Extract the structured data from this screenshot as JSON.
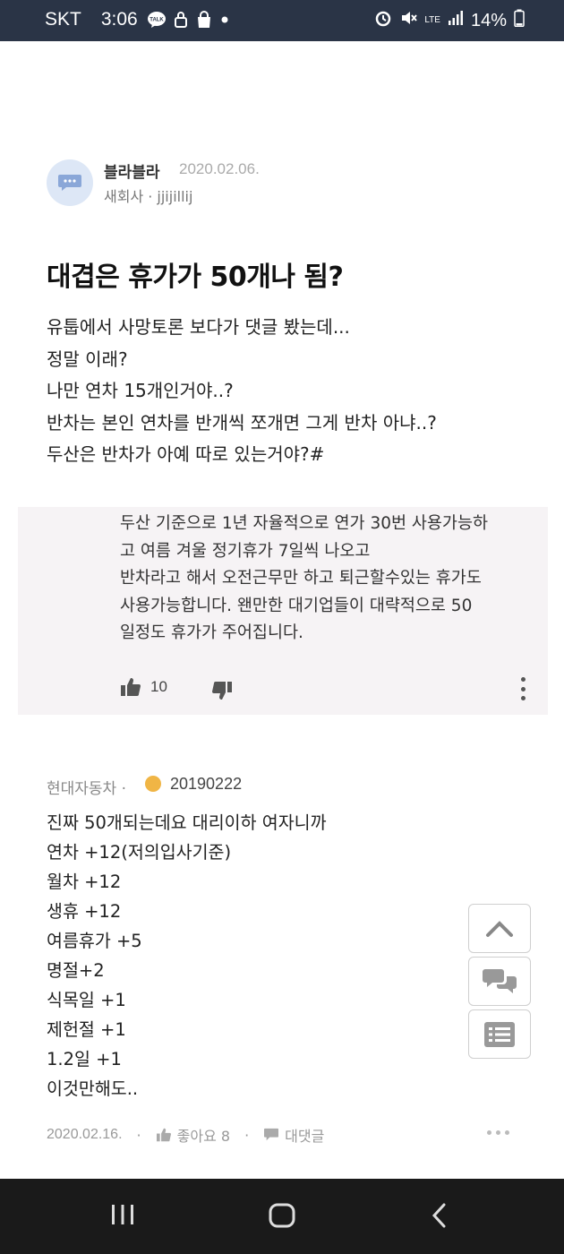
{
  "status_bar": {
    "carrier": "SKT",
    "time": "3:06",
    "talk_label": "TALK",
    "network": "LTE",
    "battery": "14%",
    "icons": [
      "talk-icon",
      "lock-icon",
      "shopping-bag-icon",
      "alarm-icon",
      "mute-icon",
      "signal-icon",
      "battery-icon"
    ]
  },
  "post": {
    "author": "블라블라",
    "date": "2020.02.06.",
    "meta": "새회사 · jjijillij",
    "title": "대겹은 휴가가 50개나 됨?",
    "body_lines": [
      "유툽에서 사망토론 보다가 댓글 봤는데...",
      "정말 이래?",
      "나만 연차 15개인거야..?",
      "반차는 본인 연차를 반개씩 쪼개면 그게 반차 아냐..?",
      "두산은 반차가 아예 따로 있는거야?#"
    ]
  },
  "quoted_comment": {
    "lines": [
      "두산 기준으로 1년 자율적으로 연가 30번 사용가능하",
      "고 여름 겨울 정기휴가 7일씩 나오고",
      "반차라고 해서 오전근무만 하고 퇴근할수있는 휴가도",
      "사용가능합니다. 왠만한 대기업들이 대략적으로 50",
      "일정도 휴가가 주어집니다."
    ],
    "likes": "10"
  },
  "comment": {
    "company": "현대자동차 ·",
    "user_id": "20190222",
    "body_lines": [
      "진짜 50개되는데요 대리이하 여자니까",
      "연차 +12(저의입사기준)",
      "월차 +12",
      "생휴 +12",
      "여름휴가 +5",
      "명절+2",
      "식목일 +1",
      "제헌절 +1",
      "1.2일 +1",
      "이것만해도.."
    ],
    "date": "2020.02.16.",
    "like_label": "좋아요 8",
    "reply_label": "대댓글"
  },
  "colors": {
    "status_bar": "#2a3446",
    "quote_bg": "#f6f3f5",
    "nav_bar": "#1a1a1a",
    "badge": "#f0b545"
  }
}
